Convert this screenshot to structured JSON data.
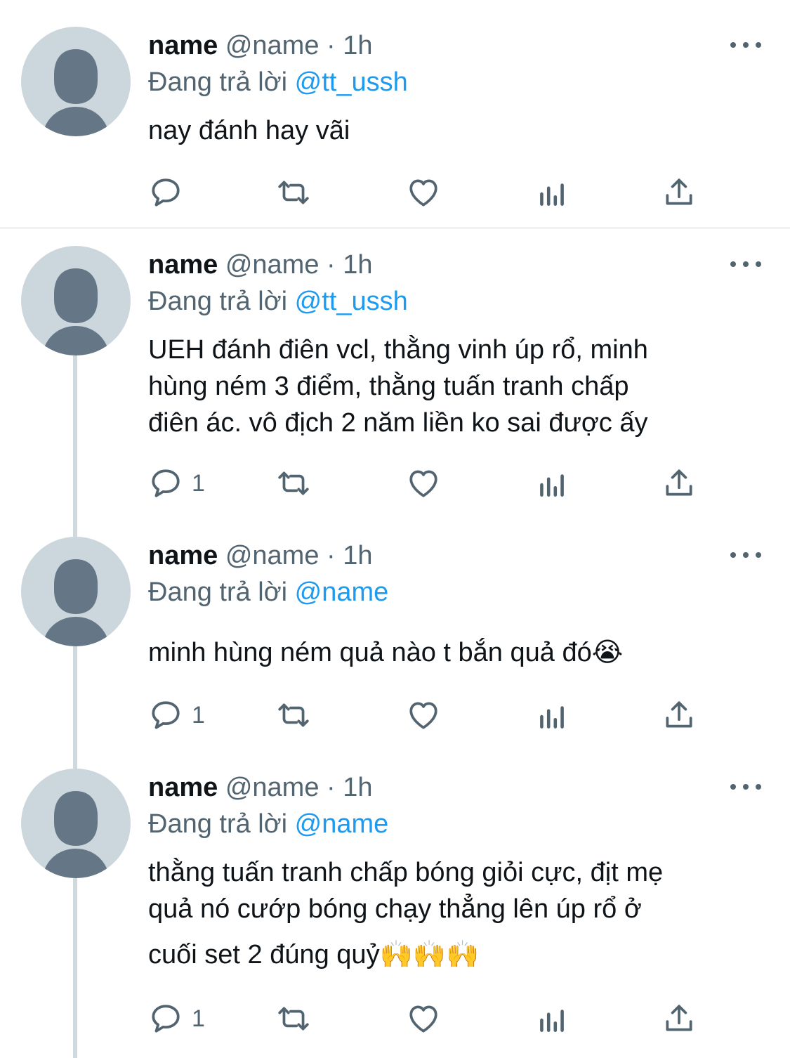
{
  "colors": {
    "text": "#0f1419",
    "secondary": "#536471",
    "accent": "#1d9bf0",
    "avatar_bg": "#ccd6dd",
    "avatar_fg": "#657786",
    "thread_line": "#cfd9de",
    "divider": "#eff3f4"
  },
  "action_icons": [
    "reply-icon",
    "retweet-icon",
    "like-icon",
    "analytics-icon",
    "share-icon"
  ],
  "tweets": [
    {
      "display_name": "name",
      "handle": "@name",
      "separator": "·",
      "time": "1h",
      "replying_prefix": "Đang trả lời",
      "replying_to": "@tt_ussh",
      "lines": [
        "nay đánh hay vãi"
      ],
      "emoji": "",
      "reply_count": ""
    },
    {
      "display_name": "name",
      "handle": "@name",
      "separator": "·",
      "time": "1h",
      "replying_prefix": "Đang trả lời",
      "replying_to": "@tt_ussh",
      "lines": [
        "UEH đánh điên vcl, thằng vinh úp rổ, minh",
        "hùng ném 3 điểm, thằng tuấn tranh chấp",
        "điên ác. vô địch 2 năm liền ko sai được ấy"
      ],
      "emoji": "",
      "reply_count": "1"
    },
    {
      "display_name": "name",
      "handle": "@name",
      "separator": "·",
      "time": "1h",
      "replying_prefix": "Đang trả lời",
      "replying_to": "@name",
      "lines": [
        "minh hùng ném quả nào t bắn quả đó"
      ],
      "emoji": "😭",
      "reply_count": "1"
    },
    {
      "display_name": "name",
      "handle": "@name",
      "separator": "·",
      "time": "1h",
      "replying_prefix": "Đang trả lời",
      "replying_to": "@name",
      "lines": [
        "thằng tuấn tranh chấp bóng giỏi cực, địt mẹ",
        "quả nó cướp bóng chạy thẳng lên úp rổ ở",
        "cuối set 2 đúng quỷ"
      ],
      "emoji": "🙌🙌🙌",
      "reply_count": "1"
    }
  ]
}
